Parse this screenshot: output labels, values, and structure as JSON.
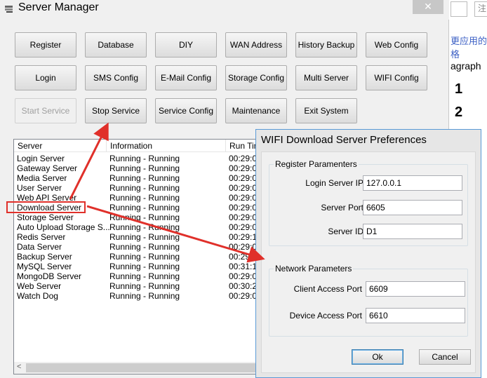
{
  "background_app": {
    "chinese_text": "更应用的格",
    "paragraph_text": "agraph",
    "list_numbers": [
      "1",
      "2"
    ],
    "right_char": "注"
  },
  "window": {
    "title": "Server Manager",
    "close_glyph": "✕"
  },
  "buttons": {
    "row1": [
      "Register",
      "Database",
      "DIY",
      "WAN Address",
      "History Backup",
      "Web Config"
    ],
    "row2": [
      "Login",
      "SMS Config",
      "E-Mail Config",
      "Storage Config",
      "Multi Server",
      "WIFI Config"
    ],
    "row3": [
      "Start Service",
      "Stop Service",
      "Service Config",
      "Maintenance",
      "Exit System"
    ]
  },
  "server_list": {
    "columns": [
      "Server",
      "Information",
      "Run Time"
    ],
    "rows": [
      {
        "server": "Login Server",
        "info": "Running - Running",
        "time": "00:29:0"
      },
      {
        "server": "Gateway Server",
        "info": "Running - Running",
        "time": "00:29:0"
      },
      {
        "server": "Media Server",
        "info": "Running - Running",
        "time": "00:29:0"
      },
      {
        "server": "User Server",
        "info": "Running - Running",
        "time": "00:29:0"
      },
      {
        "server": "Web API Server",
        "info": "Running - Running",
        "time": "00:29:0"
      },
      {
        "server": "Download Server",
        "info": "Running - Running",
        "time": "00:29:0"
      },
      {
        "server": "Storage Server",
        "info": "Running - Running",
        "time": "00:29:0"
      },
      {
        "server": "Auto Upload Storage S...",
        "info": "Running - Running",
        "time": "00:29:0"
      },
      {
        "server": "Redis Server",
        "info": "Running - Running",
        "time": "00:29:1"
      },
      {
        "server": "Data Server",
        "info": "Running - Running",
        "time": "00:29:0"
      },
      {
        "server": "Backup Server",
        "info": "Running - Running",
        "time": "00:29:1"
      },
      {
        "server": "MySQL Server",
        "info": "Running - Running",
        "time": "00:31:1"
      },
      {
        "server": "MongoDB Server",
        "info": "Running - Running",
        "time": "00:29:0"
      },
      {
        "server": "Web Server",
        "info": "Running - Running",
        "time": "00:30:2"
      },
      {
        "server": "Watch Dog",
        "info": "Running - Running",
        "time": "00:29:0"
      }
    ],
    "scroll_left_glyph": "<"
  },
  "dialog": {
    "title": "WIFI Download Server Preferences",
    "register_group": {
      "label": "Register Paramenters",
      "fields": [
        {
          "label": "Login Server IP",
          "value": "127.0.0.1"
        },
        {
          "label": "Server Port",
          "value": "6605"
        },
        {
          "label": "Server ID",
          "value": "D1"
        }
      ]
    },
    "network_group": {
      "label": "Network Parameters",
      "fields": [
        {
          "label": "Client Access Port",
          "value": "6609"
        },
        {
          "label": "Device Access Port",
          "value": "6610"
        }
      ]
    },
    "ok_label": "Ok",
    "cancel_label": "Cancel"
  },
  "annotation_color": "#e0302a"
}
